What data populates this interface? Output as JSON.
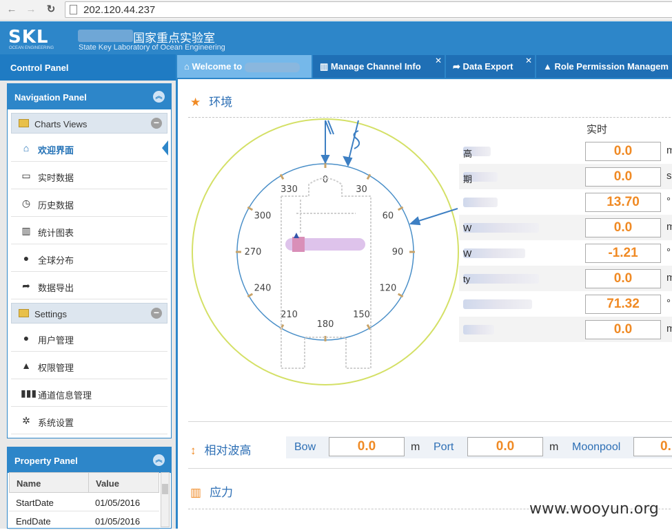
{
  "browser": {
    "url": "202.120.44.237",
    "back": "←",
    "forward": "→",
    "reload": "↻"
  },
  "header": {
    "logo": "SKL",
    "logo_sub": "OCEAN ENGINEERING",
    "lab_name": "国家重点实验室",
    "lab_name_en": "State Key Laboratory of Ocean Engineering"
  },
  "sidebar": {
    "control_panel": "Control Panel",
    "navigation_panel": "Navigation Panel",
    "groups": [
      {
        "label": "Charts Views",
        "items": [
          "欢迎界面",
          "实时数据",
          "历史数据",
          "统计图表",
          "全球分布",
          "数据导出"
        ]
      },
      {
        "label": "Settings",
        "items": [
          "用户管理",
          "权限管理",
          "通道信息管理",
          "系统设置"
        ]
      }
    ],
    "property_panel": "Property Panel",
    "property_headers": [
      "Name",
      "Value"
    ],
    "properties": [
      {
        "name": "StartDate",
        "value": "01/05/2016"
      },
      {
        "name": "EndDate",
        "value": "01/05/2016"
      }
    ]
  },
  "tabs": [
    {
      "label": "Welcome to",
      "icon": "home-icon"
    },
    {
      "label": "Manage Channel Info",
      "icon": "barcode-icon"
    },
    {
      "label": "Data Export",
      "icon": "share-icon"
    },
    {
      "label": "Role Permission Managem",
      "icon": "warning-icon"
    }
  ],
  "environment": {
    "title": "环境",
    "realtime_label": "实时",
    "compass_labels": [
      "0",
      "30",
      "60",
      "90",
      "120",
      "150",
      "180",
      "210",
      "240",
      "270",
      "300",
      "330"
    ],
    "readings": [
      {
        "label": "高",
        "value": "0.0",
        "unit": "m"
      },
      {
        "label": "期",
        "value": "0.0",
        "unit": "s"
      },
      {
        "label": "",
        "value": "13.70",
        "unit": "°"
      },
      {
        "label": "W",
        "value": "0.0",
        "unit": "m"
      },
      {
        "label": "W",
        "value": "-1.21",
        "unit": "°"
      },
      {
        "label": "ty",
        "value": "0.0",
        "unit": "m"
      },
      {
        "label": "",
        "value": "71.32",
        "unit": "°"
      },
      {
        "label": "",
        "value": "0.0",
        "unit": "m"
      }
    ]
  },
  "wave": {
    "title": "相对波高",
    "items": [
      {
        "label": "Bow",
        "value": "0.0",
        "unit": "m"
      },
      {
        "label": "Port",
        "value": "0.0",
        "unit": "m"
      },
      {
        "label": "Moonpool",
        "value": "0."
      }
    ]
  },
  "stress": {
    "title": "应力"
  },
  "watermark": "www.wooyun.org",
  "colors": {
    "primary": "#2d86c9",
    "value": "#f08a24"
  }
}
